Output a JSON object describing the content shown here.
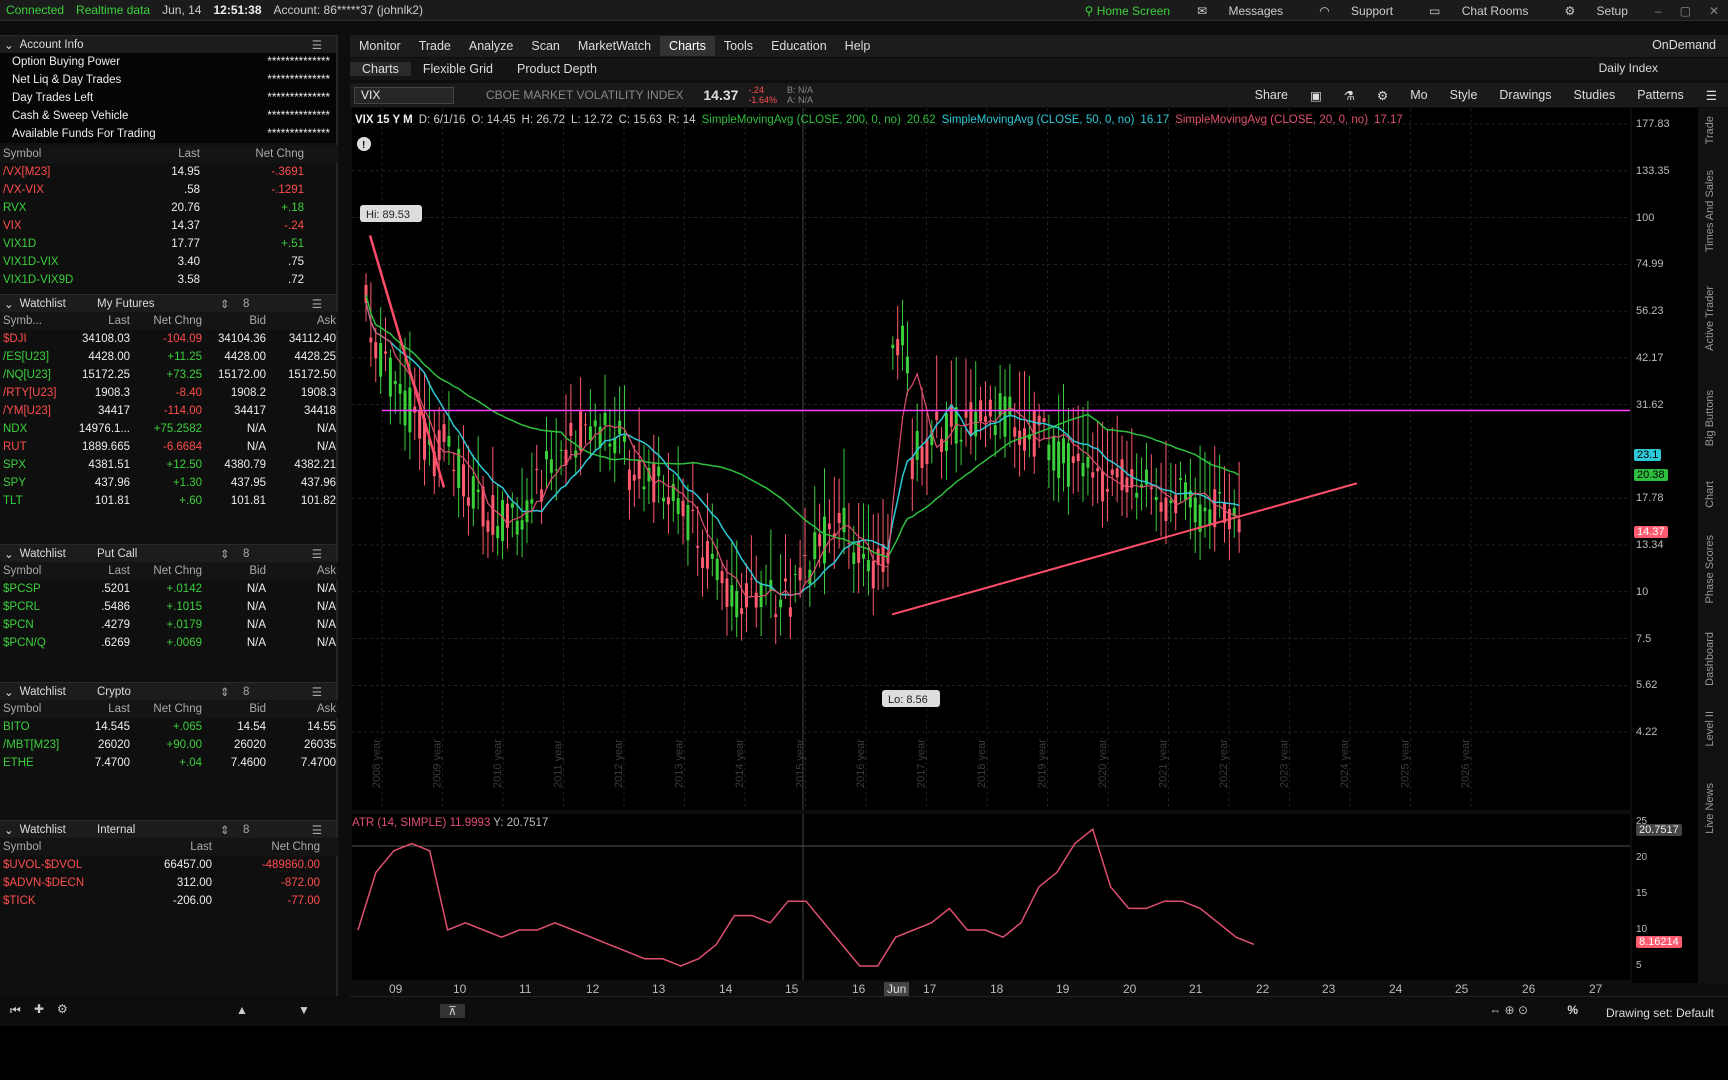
{
  "topbar": {
    "status": "Connected",
    "realtime": "Realtime data",
    "date": "Jun, 14",
    "time": "12:51:38",
    "account": "Account: 86*****37 (johnlk2)",
    "home": "Home Screen",
    "messages": "Messages",
    "support": "Support",
    "chat": "Chat Rooms",
    "setup": "Setup"
  },
  "account": {
    "title": "Account Info",
    "rows": [
      {
        "label": "Option Buying Power",
        "value": "**************"
      },
      {
        "label": "Net Liq & Day Trades",
        "value": "**************"
      },
      {
        "label": "Day Trades Left",
        "value": "**************"
      },
      {
        "label": "Cash & Sweep Vehicle",
        "value": "**************"
      },
      {
        "label": "Available Funds For Trading",
        "value": "**************"
      }
    ]
  },
  "vixlist": {
    "headers": [
      "Symbol",
      "Last",
      "Net Chng"
    ],
    "rows": [
      [
        "/VX[M23]",
        "14.95",
        "-.3691"
      ],
      [
        "/VX-VIX",
        ".58",
        "-.1291"
      ],
      [
        "RVX",
        "20.76",
        "+.18"
      ],
      [
        "VIX",
        "14.37",
        "-.24"
      ],
      [
        "VIX1D",
        "17.77",
        "+.51"
      ],
      [
        "VIX1D-VIX",
        "3.40",
        ".75"
      ],
      [
        "VIX1D-VIX9D",
        "3.58",
        ".72"
      ]
    ]
  },
  "futures": {
    "title": "Watchlist",
    "name": "My Futures",
    "headers": [
      "Symb...",
      "Last",
      "Net Chng",
      "Bid",
      "Ask"
    ],
    "rows": [
      [
        "$DJI",
        "34108.03",
        "-104.09",
        "34104.36",
        "34112.40"
      ],
      [
        "/ES[U23]",
        "4428.00",
        "+11.25",
        "4428.00",
        "4428.25"
      ],
      [
        "/NQ[U23]",
        "15172.25",
        "+73.25",
        "15172.00",
        "15172.50"
      ],
      [
        "/RTY[U23]",
        "1908.3",
        "-8.40",
        "1908.2",
        "1908.3"
      ],
      [
        "/YM[U23]",
        "34417",
        "-114.00",
        "34417",
        "34418"
      ],
      [
        "NDX",
        "14976.1...",
        "+75.2582",
        "N/A",
        "N/A"
      ],
      [
        "RUT",
        "1889.665",
        "-6.6684",
        "N/A",
        "N/A"
      ],
      [
        "SPX",
        "4381.51",
        "+12.50",
        "4380.79",
        "4382.21"
      ],
      [
        "SPY",
        "437.96",
        "+1.30",
        "437.95",
        "437.96"
      ],
      [
        "TLT",
        "101.81",
        "+.60",
        "101.81",
        "101.82"
      ]
    ]
  },
  "putcall": {
    "title": "Watchlist",
    "name": "Put Call",
    "headers": [
      "Symbol",
      "Last",
      "Net Chng",
      "Bid",
      "Ask"
    ],
    "rows": [
      [
        "$PCSP",
        ".5201",
        "+.0142",
        "N/A",
        "N/A"
      ],
      [
        "$PCRL",
        ".5486",
        "+.1015",
        "N/A",
        "N/A"
      ],
      [
        "$PCN",
        ".4279",
        "+.0179",
        "N/A",
        "N/A"
      ],
      [
        "$PCN/Q",
        ".6269",
        "+.0069",
        "N/A",
        "N/A"
      ]
    ]
  },
  "crypto": {
    "title": "Watchlist",
    "name": "Crypto",
    "headers": [
      "Symbol",
      "Last",
      "Net Chng",
      "Bid",
      "Ask"
    ],
    "rows": [
      [
        "BITO",
        "14.545",
        "+.065",
        "14.54",
        "14.55"
      ],
      [
        "/MBT[M23]",
        "26020",
        "+90.00",
        "26020",
        "26035"
      ],
      [
        "ETHE",
        "7.4700",
        "+.04",
        "7.4600",
        "7.4700"
      ]
    ]
  },
  "internal": {
    "title": "Watchlist",
    "name": "Internal",
    "headers": [
      "Symbol",
      "Last",
      "Net Chng"
    ],
    "rows": [
      [
        "$UVOL-$DVOL",
        "66457.00",
        "-489860.00"
      ],
      [
        "$ADVN-$DECN",
        "312.00",
        "-872.00"
      ],
      [
        "$TICK",
        "-206.00",
        "-77.00"
      ]
    ]
  },
  "menu": {
    "items": [
      "Monitor",
      "Trade",
      "Analyze",
      "Scan",
      "MarketWatch",
      "Charts",
      "Tools",
      "Education",
      "Help"
    ],
    "active": "Charts",
    "ondemand": "OnDemand"
  },
  "submenu": {
    "items": [
      "Charts",
      "Flexible Grid",
      "Product Depth"
    ],
    "daily_index": "Daily Index"
  },
  "chartbar": {
    "symbol": "VIX",
    "name": "CBOE MARKET VOLATILITY INDEX",
    "price": "14.37",
    "chg": "-.24",
    "chgpct": "-1.64%",
    "bid": "B: N/A",
    "ask": "A: N/A",
    "share": "Share",
    "mo": "Mo",
    "style": "Style",
    "drawings": "Drawings",
    "studies": "Studies",
    "patterns": "Patterns"
  },
  "study": {
    "period": "VIX 15 Y M",
    "d": "D: 6/1/16",
    "o": "O: 14.45",
    "h": "H: 26.72",
    "l": "L: 12.72",
    "c": "C: 15.63",
    "r": "R: 14",
    "sma200": "SimpleMovingAvg (CLOSE, 200, 0, no)",
    "sma200v": "20.62",
    "sma50": "SimpleMovingAvg (CLOSE, 50, 0, no)",
    "sma50v": "16.17",
    "sma20": "SimpleMovingAvg (CLOSE, 20, 0, no)",
    "sma20v": "17.17"
  },
  "price_axis": [
    "177.83",
    "133.35",
    "100",
    "74.99",
    "56.23",
    "42.17",
    "31.62",
    "17.78",
    "13.34",
    "10",
    "7.5",
    "5.62",
    "4.22"
  ],
  "price_tags": {
    "sma50": "23.1",
    "sma200": "20.38",
    "last": "14.37"
  },
  "annotations": {
    "hi": "Hi: 89.53",
    "lo": "Lo: 8.56"
  },
  "year_labels": [
    "2008 year",
    "2009 year",
    "2010 year",
    "2011 year",
    "2012 year",
    "2013 year",
    "2014 year",
    "2015 year",
    "2016 year",
    "2017 year",
    "2018 year",
    "2019 year",
    "2020 year",
    "2021 year",
    "2022 year",
    "2023 year",
    "2024 year",
    "2025 year",
    "2026 year"
  ],
  "atr": {
    "label": "ATR (14, SIMPLE)",
    "value": "11.9993",
    "y": "Y: 20.7517",
    "axis": [
      "25",
      "20",
      "15",
      "10",
      "5"
    ],
    "tag_top": "20.7517",
    "tag_cur": "8.16214"
  },
  "xaxis": [
    "09",
    "10",
    "11",
    "12",
    "13",
    "14",
    "15",
    "16",
    "Jun",
    "17",
    "18",
    "19",
    "20",
    "21",
    "22",
    "23",
    "24",
    "25",
    "26",
    "27"
  ],
  "side_tabs": [
    "Trade",
    "Times And Sales",
    "Active Trader",
    "Big Buttons",
    "Chart",
    "Phase Scores",
    "Dashboard",
    "Level II",
    "Live News"
  ],
  "footer": {
    "drawing": "Drawing set: Default"
  },
  "colors": {
    "up": "#3bd03b",
    "down": "#ff5a6e",
    "sma200": "#2fbf3f",
    "sma50": "#2fc8d8",
    "sma20": "#e05070",
    "resistance": "#ff40ff"
  },
  "chart_data": {
    "type": "candlestick",
    "symbol": "VIX",
    "period": "15 Y M",
    "log_scale": true,
    "yticks": [
      177.83,
      133.35,
      100,
      74.99,
      56.23,
      42.17,
      31.62,
      17.78,
      13.34,
      10,
      7.5,
      5.62,
      4.22
    ],
    "hi": 89.53,
    "lo": 8.56,
    "last": 14.37,
    "resistance": 30.5
  },
  "atr_data": {
    "type": "line",
    "name": "ATR (14, SIMPLE)",
    "ylim": [
      5,
      25
    ],
    "values": [
      10,
      18,
      21,
      22,
      21,
      10,
      11,
      10,
      9,
      10,
      10,
      11,
      10,
      9,
      8,
      7,
      6,
      6,
      5,
      6,
      8,
      12,
      12,
      11,
      14,
      14,
      11,
      8,
      5,
      5,
      9,
      10,
      11,
      13,
      10,
      10,
      9,
      11,
      16,
      18,
      22,
      24,
      16,
      13,
      13,
      14,
      14,
      13,
      11,
      9,
      8
    ]
  }
}
